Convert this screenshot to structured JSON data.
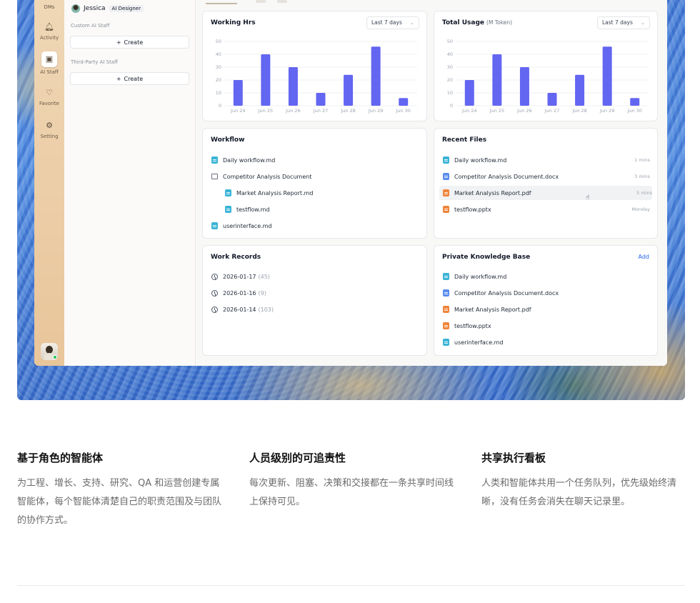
{
  "rail": {
    "items": [
      {
        "label": "DMs",
        "icon": "chat-icon"
      },
      {
        "label": "Activity",
        "icon": "bell-icon"
      },
      {
        "label": "AI Staff",
        "icon": "robot-icon"
      },
      {
        "label": "Favorite",
        "icon": "heart-icon"
      },
      {
        "label": "Setting",
        "icon": "gear-icon"
      }
    ],
    "active": "AI Staff"
  },
  "panel": {
    "user_name": "Jessica",
    "user_badge": "AI Designer",
    "custom_label": "Custom AI Staff",
    "third_party_label": "Third-Party AI Staff",
    "create_label": "Create"
  },
  "working_hrs": {
    "title": "Working Hrs",
    "range": "Last 7 days"
  },
  "total_usage": {
    "title": "Total Usage",
    "unit": "(M Token)",
    "range": "Last 7 days"
  },
  "chart_data": [
    {
      "type": "bar",
      "title": "Working Hrs",
      "categories": [
        "Jun 24",
        "Jun 25",
        "Jun 26",
        "Jun 27",
        "Jun 28",
        "Jun 29",
        "Jun 30"
      ],
      "values": [
        20,
        40,
        30,
        10,
        24,
        46,
        6
      ],
      "ylim": [
        0,
        50
      ],
      "yticks": [
        0,
        10,
        20,
        30,
        40,
        50
      ],
      "grid": true,
      "color": "#6366f1"
    },
    {
      "type": "bar",
      "title": "Total Usage",
      "categories": [
        "Jun 24",
        "Jun 25",
        "Jun 26",
        "Jun 27",
        "Jun 28",
        "Jun 29",
        "Jun 30"
      ],
      "values": [
        20,
        40,
        30,
        10,
        24,
        46,
        6
      ],
      "ylim": [
        0,
        50
      ],
      "yticks": [
        0,
        10,
        20,
        30,
        40,
        50
      ],
      "grid": true,
      "color": "#6366f1"
    }
  ],
  "workflow": {
    "title": "Workflow",
    "items": [
      {
        "name": "Daily workflow.md",
        "type": "md",
        "indent": 0
      },
      {
        "name": "Competitor Analysis Document",
        "type": "folder",
        "indent": 0
      },
      {
        "name": "Market Analysis Report.md",
        "type": "md",
        "indent": 1
      },
      {
        "name": "testflow.md",
        "type": "md",
        "indent": 1
      },
      {
        "name": "userinterface.md",
        "type": "md",
        "indent": 0
      }
    ]
  },
  "recent_files": {
    "title": "Recent Files",
    "items": [
      {
        "name": "Daily workflow.md",
        "type": "md",
        "time": "1 mins"
      },
      {
        "name": "Competitor Analysis Document.docx",
        "type": "docx",
        "time": "3 mins"
      },
      {
        "name": "Market Analysis Report.pdf",
        "type": "pdf",
        "time": "5 mins"
      },
      {
        "name": "testflow.pptx",
        "type": "pptx",
        "time": "Monday"
      }
    ]
  },
  "work_records": {
    "title": "Work Records",
    "items": [
      {
        "date": "2026-01-17",
        "count": "(45)"
      },
      {
        "date": "2026-01-16",
        "count": "(9)"
      },
      {
        "date": "2026-01-14",
        "count": "(103)"
      }
    ]
  },
  "knowledge_base": {
    "title": "Private Knowledge Base",
    "action": "Add",
    "items": [
      {
        "name": "Daily workflow.md",
        "type": "md"
      },
      {
        "name": "Competitor Analysis Document.docx",
        "type": "docx"
      },
      {
        "name": "Market Analysis Report.pdf",
        "type": "pdf"
      },
      {
        "name": "testflow.pptx",
        "type": "pptx"
      },
      {
        "name": "userinterface.md",
        "type": "md"
      }
    ]
  },
  "features": [
    {
      "title": "基于角色的智能体",
      "body": "为工程、增长、支持、研究、QA 和运营创建专属智能体，每个智能体清楚自己的职责范围及与团队的协作方式。"
    },
    {
      "title": "人员级别的可追责性",
      "body": "每次更新、阻塞、决策和交接都在一条共享时间线上保持可见。"
    },
    {
      "title": "共享执行看板",
      "body": "人类和智能体共用一个任务队列，优先级始终清晰，没有任务会消失在聊天记录里。"
    }
  ]
}
